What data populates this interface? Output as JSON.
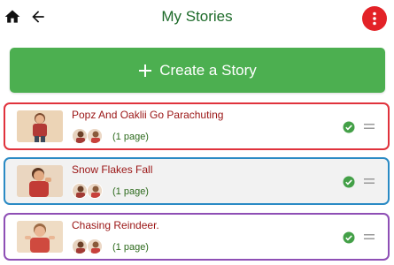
{
  "header": {
    "title": "My Stories",
    "home_icon": "home-icon",
    "back_icon": "arrow-left-icon",
    "menu_icon": "more-vertical-icon"
  },
  "create": {
    "label": "Create a Story",
    "icon": "plus-icon"
  },
  "stories": [
    {
      "title": "Popz And Oaklii Go Parachuting",
      "pages": "(1 page)",
      "border_color": "#e0323c",
      "completed": true
    },
    {
      "title": "Snow Flakes Fall",
      "pages": "(1 page)",
      "border_color": "#2a8ac4",
      "completed": true
    },
    {
      "title": "Chasing Reindeer.",
      "pages": "(1 page)",
      "border_color": "#8e4fb5",
      "completed": true
    }
  ],
  "colors": {
    "brand_green": "#4caf50",
    "title_green": "#1e6b2a",
    "menu_red": "#e32227",
    "story_title_red": "#9a1414"
  }
}
